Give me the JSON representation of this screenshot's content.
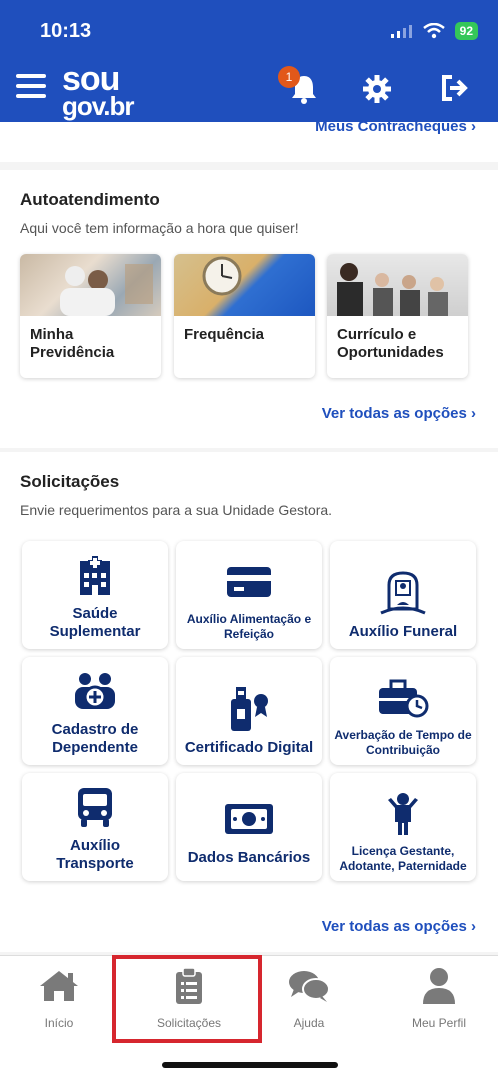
{
  "status_bar": {
    "time": "10:13",
    "battery": "92"
  },
  "header": {
    "logo_line1": "sou",
    "logo_line2": "gov.br",
    "notification_count": "1"
  },
  "peek_link": "Meus Contracheques",
  "autoatendimento": {
    "title": "Autoatendimento",
    "subtitle": "Aqui você tem informação a hora que quiser!",
    "cards": [
      {
        "label": "Minha Previdência"
      },
      {
        "label": "Frequência"
      },
      {
        "label": "Currículo e Oportunidades"
      }
    ],
    "see_all": "Ver todas as opções"
  },
  "solicitacoes": {
    "title": "Solicitações",
    "subtitle": "Envie requerimentos para a sua Unidade Gestora.",
    "items": [
      {
        "label": "Saúde Suplementar",
        "icon": "hospital-icon"
      },
      {
        "label": "Auxílio Alimentação e Refeição",
        "icon": "card-icon"
      },
      {
        "label": "Auxílio Funeral",
        "icon": "tombstone-icon"
      },
      {
        "label": "Cadastro de Dependente",
        "icon": "add-dependent-icon"
      },
      {
        "label": "Certificado Digital",
        "icon": "certificate-icon"
      },
      {
        "label": "Averbação de Tempo de Contribuição",
        "icon": "briefcase-clock-icon"
      },
      {
        "label": "Auxílio Transporte",
        "icon": "bus-icon"
      },
      {
        "label": "Dados Bancários",
        "icon": "banknote-icon"
      },
      {
        "label": "Licença Gestante, Adotante, Paternidade",
        "icon": "person-icon"
      }
    ],
    "see_all": "Ver todas as opções"
  },
  "bottom_nav": [
    {
      "label": "Início",
      "icon": "home-icon"
    },
    {
      "label": "Solicitações",
      "icon": "clipboard-icon"
    },
    {
      "label": "Ajuda",
      "icon": "chat-icon"
    },
    {
      "label": "Meu Perfil",
      "icon": "user-icon"
    }
  ],
  "colors": {
    "brand": "#1f4fbd",
    "navy": "#0f2c6e",
    "highlight": "#d6262e"
  }
}
